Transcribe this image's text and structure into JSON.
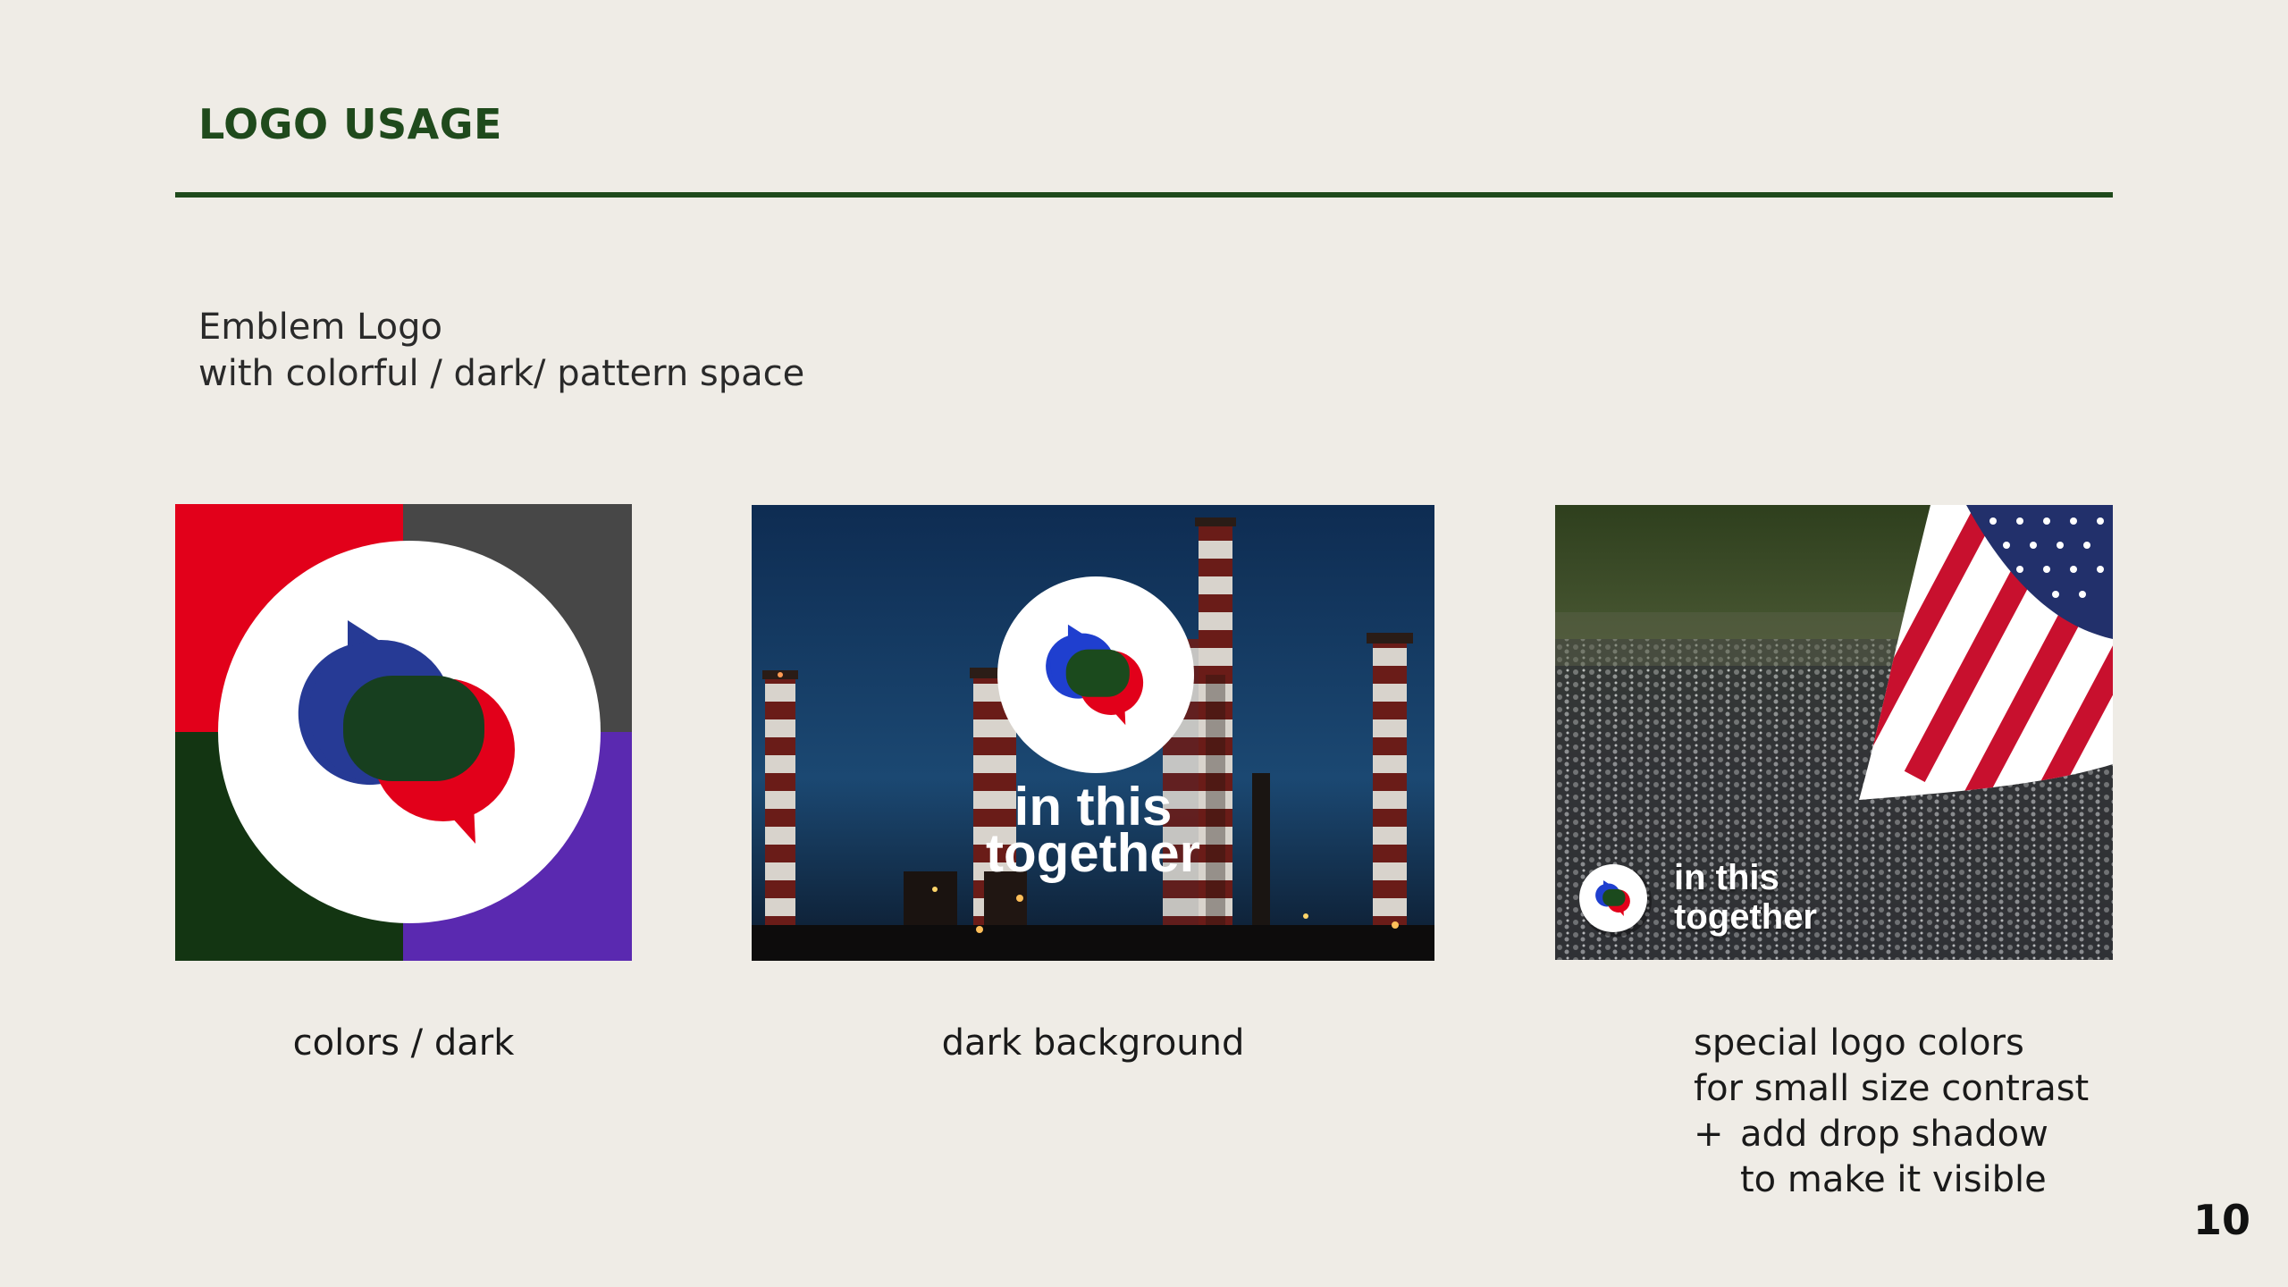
{
  "header": {
    "title": "LOGO USAGE"
  },
  "intro": {
    "line1": "Emblem Logo",
    "line2": "with colorful / dark/ pattern space"
  },
  "panels": [
    {
      "caption": "colors / dark",
      "quadrant_colors": [
        "#e2001a",
        "#474747",
        "#133512",
        "#5a29b0"
      ]
    },
    {
      "caption": "dark background",
      "logo_line1": "in this",
      "logo_line2": "together"
    },
    {
      "caption_line1": "special logo colors",
      "caption_line2": "for small size contrast",
      "caption_plus": "+",
      "caption_line3": "add drop shadow",
      "caption_line4": "to make it visible",
      "logo_line1": "in this",
      "logo_line2": "together"
    }
  ],
  "brand_colors": {
    "blue": "#1f3fcf",
    "green": "#1b4a1d",
    "red": "#e2001a",
    "title_green": "#1f4a1c"
  },
  "page_number": "10"
}
